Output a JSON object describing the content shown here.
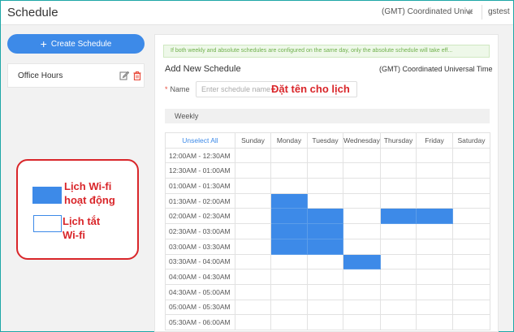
{
  "header": {
    "title": "Schedule",
    "timezone_select": "(GMT) Coordinated Univer",
    "user": "gstest"
  },
  "sidebar": {
    "create_button": "Create Schedule",
    "items": [
      {
        "label": "Office Hours"
      }
    ]
  },
  "legend": {
    "active_label": "Lịch Wi-fi hoạt động",
    "off_label": "Lịch tắt Wi-fi",
    "active_color": "#3d8ae8"
  },
  "form": {
    "notice": "If both weekly and absolute schedules are configured on the same day, only the absolute schedule will take eff...",
    "title": "Add New Schedule",
    "timezone": "(GMT) Coordinated Universal Time",
    "name_label": "Name",
    "name_placeholder": "Enter schedule name",
    "name_value": "",
    "name_annotation": "Đặt tên cho lịch",
    "tab": "Weekly"
  },
  "grid": {
    "unselect_all": "Unselect All",
    "days": [
      "Sunday",
      "Monday",
      "Tuesday",
      "Wednesday",
      "Thursday",
      "Friday",
      "Saturday"
    ],
    "slots": [
      "12:00AM - 12:30AM",
      "12:30AM - 01:00AM",
      "01:00AM - 01:30AM",
      "01:30AM - 02:00AM",
      "02:00AM - 02:30AM",
      "02:30AM - 03:00AM",
      "03:00AM - 03:30AM",
      "03:30AM - 04:00AM",
      "04:00AM - 04:30AM",
      "04:30AM - 05:00AM",
      "05:00AM - 05:30AM",
      "05:30AM - 06:00AM"
    ],
    "selected": {
      "Monday": [
        "01:30AM - 02:00AM",
        "02:00AM - 02:30AM",
        "02:30AM - 03:00AM",
        "03:00AM - 03:30AM"
      ],
      "Tuesday": [
        "02:00AM - 02:30AM",
        "02:30AM - 03:00AM",
        "03:00AM - 03:30AM"
      ],
      "Wednesday": [
        "03:30AM - 04:00AM"
      ],
      "Thursday": [
        "02:00AM - 02:30AM"
      ],
      "Friday": [
        "02:00AM - 02:30AM"
      ]
    }
  }
}
